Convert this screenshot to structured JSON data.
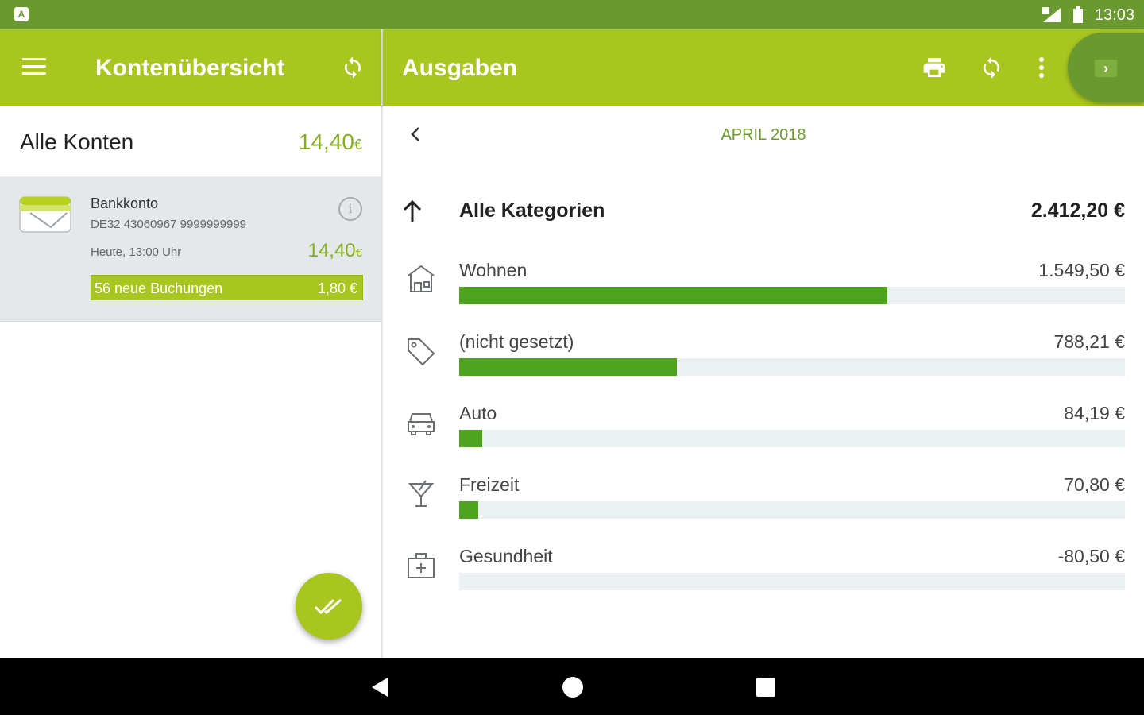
{
  "status_bar": {
    "time": "13:03",
    "app_icon_letter": "A"
  },
  "left_appbar": {
    "title": "Kontenübersicht",
    "menu_icon": "hamburger-menu-icon",
    "refresh_icon": "sync-icon"
  },
  "right_appbar": {
    "title": "Ausgaben",
    "print_icon": "printer-icon",
    "refresh_icon": "sync-icon",
    "more_icon": "more-vertical-icon",
    "toggle_icon": "chevron-right-icon"
  },
  "accounts": {
    "all_label": "Alle Konten",
    "all_amount": "14,40",
    "currency": "€",
    "items": [
      {
        "name": "Bankkonto",
        "iban": "DE32 43060967 9999999999",
        "updated": "Heute, 13:00 Uhr",
        "amount": "14,40",
        "new_bookings_label": "56 neue Buchungen",
        "new_bookings_amount": "1,80 €"
      }
    ]
  },
  "fab": {
    "icon": "double-check-icon"
  },
  "expenses": {
    "month": "APRIL 2018",
    "total": {
      "label": "Alle Kategorien",
      "amount": "2.412,20 €"
    },
    "categories": [
      {
        "name": "Wohnen",
        "amount": "1.549,50 €",
        "value": 1549.5,
        "fraction": 0.643,
        "icon": "house-icon"
      },
      {
        "name": "(nicht gesetzt)",
        "amount": "788,21 €",
        "value": 788.21,
        "fraction": 0.327,
        "icon": "tag-icon"
      },
      {
        "name": "Auto",
        "amount": "84,19 €",
        "value": 84.19,
        "fraction": 0.035,
        "icon": "car-icon"
      },
      {
        "name": "Freizeit",
        "amount": "70,80 €",
        "value": 70.8,
        "fraction": 0.029,
        "icon": "cocktail-icon"
      },
      {
        "name": "Gesundheit",
        "amount": "-80,50 €",
        "value": -80.5,
        "fraction": 0,
        "icon": "first-aid-kit-icon"
      }
    ]
  },
  "colors": {
    "appbar": "#a8c520",
    "statusbar": "#6a9a2f",
    "accent_green": "#86ad1c",
    "bar_fill": "#4ea31e",
    "bar_track": "#ecf1f4"
  }
}
